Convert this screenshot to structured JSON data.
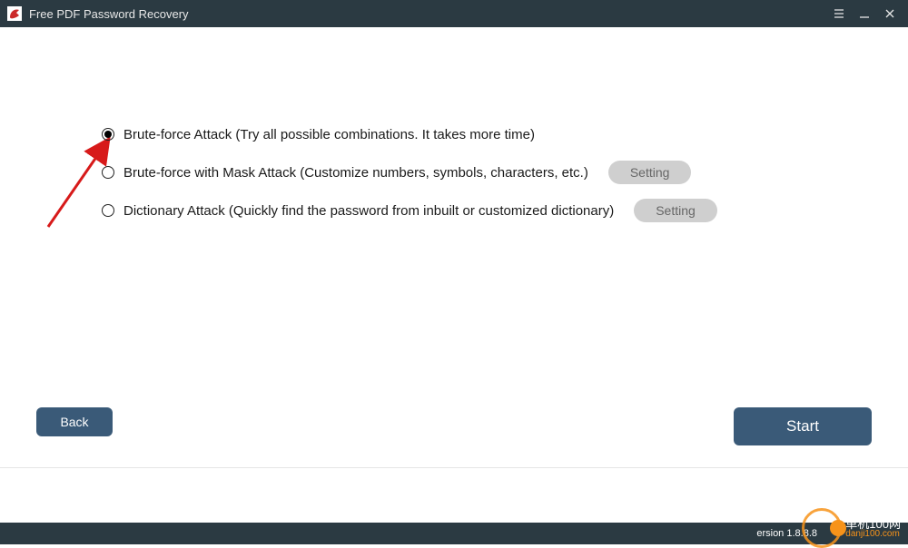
{
  "titlebar": {
    "title": "Free PDF Password Recovery"
  },
  "options": [
    {
      "label": "Brute-force Attack (Try all possible combinations. It takes more time)",
      "selected": true,
      "has_setting": false
    },
    {
      "label": "Brute-force with Mask Attack (Customize numbers, symbols, characters, etc.)",
      "selected": false,
      "has_setting": true,
      "setting_label": "Setting"
    },
    {
      "label": "Dictionary Attack (Quickly find the password from inbuilt or customized dictionary)",
      "selected": false,
      "has_setting": true,
      "setting_label": "Setting"
    }
  ],
  "buttons": {
    "back": "Back",
    "start": "Start"
  },
  "footer": {
    "version": "ersion 1.8.8.8"
  },
  "watermark": {
    "cn": "单机100网",
    "en": "danji100.com"
  }
}
